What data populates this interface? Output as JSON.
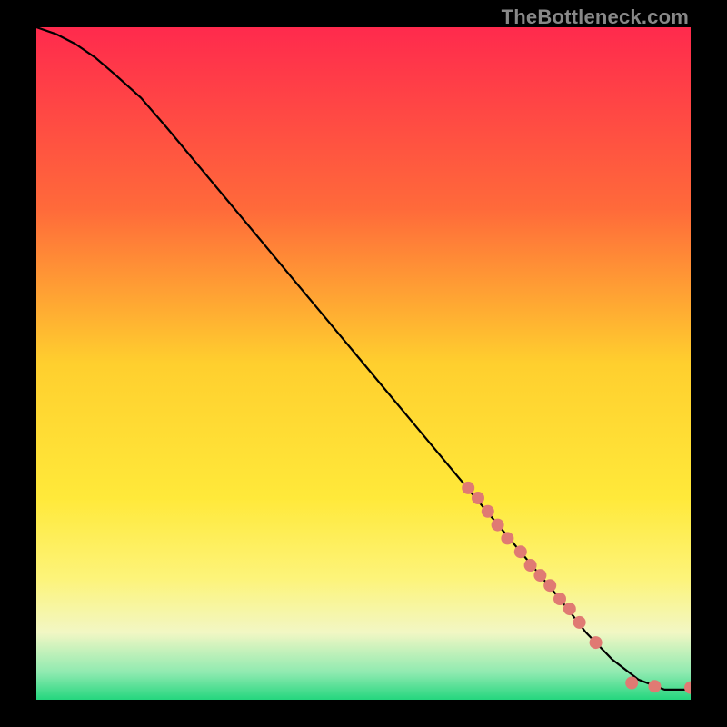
{
  "watermark": "TheBottleneck.com",
  "chart_data": {
    "type": "line",
    "title": "",
    "xlabel": "",
    "ylabel": "",
    "xlim": [
      0,
      100
    ],
    "ylim": [
      0,
      100
    ],
    "background_gradient_stops": [
      {
        "pos": 0.0,
        "color": "#ff2a4d"
      },
      {
        "pos": 0.27,
        "color": "#ff6a3a"
      },
      {
        "pos": 0.5,
        "color": "#ffcf2e"
      },
      {
        "pos": 0.7,
        "color": "#ffe93a"
      },
      {
        "pos": 0.82,
        "color": "#fdf47a"
      },
      {
        "pos": 0.9,
        "color": "#f2f7c4"
      },
      {
        "pos": 0.96,
        "color": "#8eeab0"
      },
      {
        "pos": 1.0,
        "color": "#24d67e"
      }
    ],
    "series": [
      {
        "name": "curve",
        "type": "line",
        "color": "#000000",
        "width": 2.2,
        "x": [
          0,
          3,
          6,
          9,
          12,
          16,
          20,
          26,
          32,
          38,
          44,
          50,
          56,
          62,
          68,
          74,
          80,
          84,
          88,
          92,
          96,
          100
        ],
        "y": [
          100,
          99,
          97.5,
          95.5,
          93,
          89.5,
          85,
          78,
          71,
          64,
          57,
          50,
          43,
          36,
          29,
          22,
          15,
          10,
          6,
          3,
          1.5,
          1.5
        ]
      },
      {
        "name": "highlight-points",
        "type": "scatter",
        "color": "#e07a73",
        "radius": 7,
        "x": [
          66,
          67.5,
          69,
          70.5,
          72,
          74,
          75.5,
          77,
          78.5,
          80,
          81.5,
          83,
          85.5,
          91,
          94.5,
          100
        ],
        "y": [
          31.5,
          30,
          28,
          26,
          24,
          22,
          20,
          18.5,
          17,
          15,
          13.5,
          11.5,
          8.5,
          2.5,
          2,
          1.8
        ]
      }
    ]
  }
}
